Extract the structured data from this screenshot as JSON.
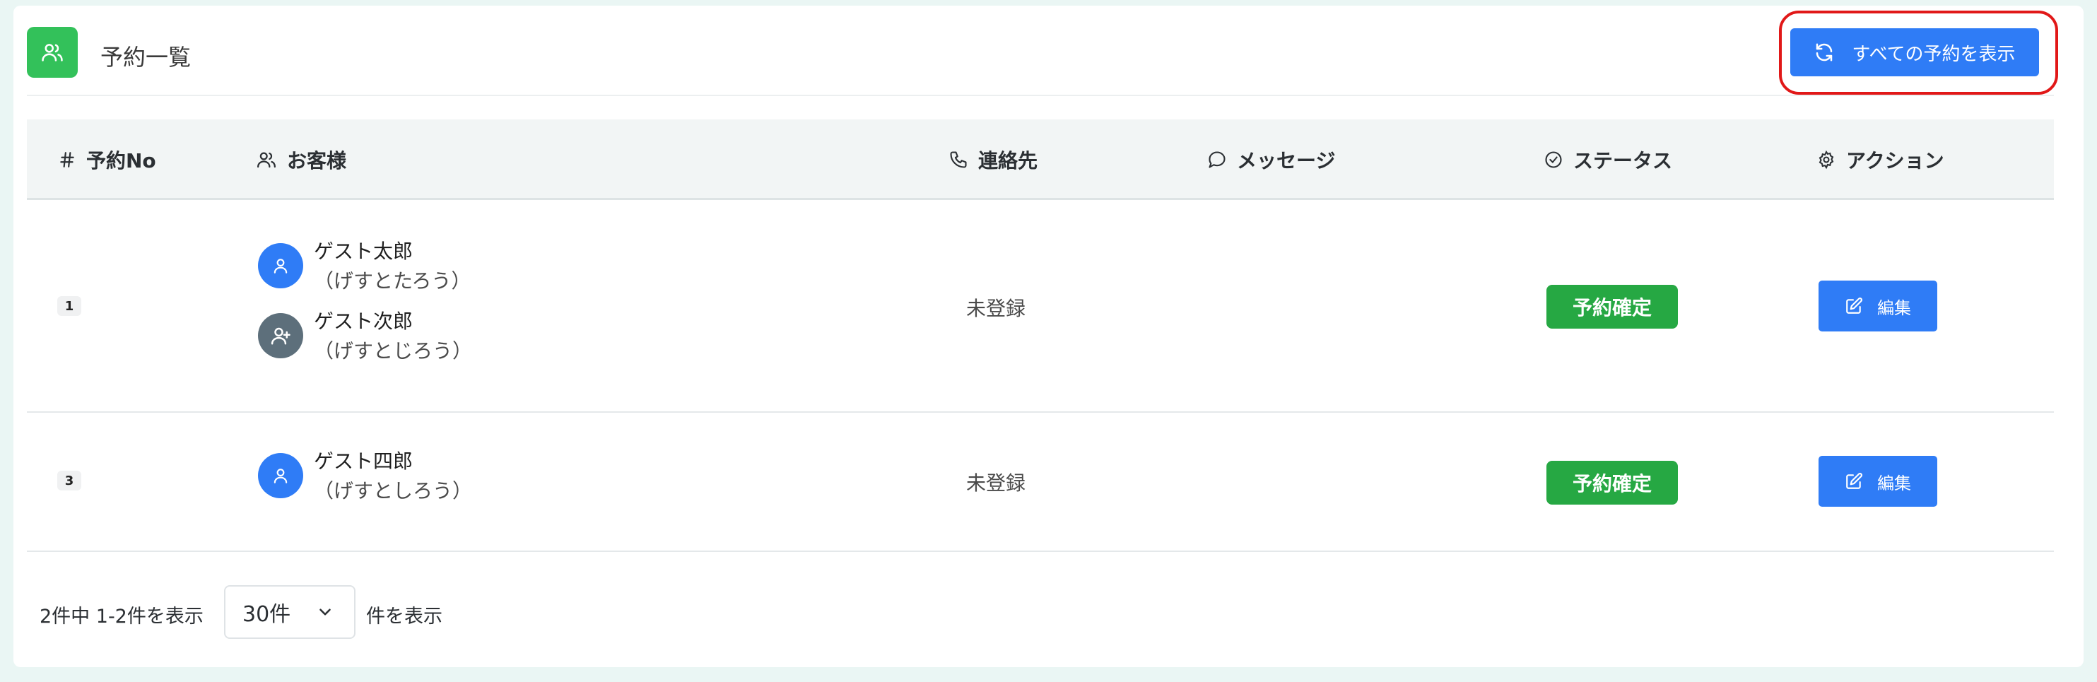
{
  "header": {
    "title": "予約一覧",
    "show_all_label": "すべての予約を表示"
  },
  "table": {
    "columns": {
      "no": "予約No",
      "customer": "お客様",
      "contact": "連絡先",
      "message": "メッセージ",
      "status": "ステータス",
      "action": "アクション"
    },
    "rows": [
      {
        "no": "1",
        "guests": [
          {
            "name": "ゲスト太郎",
            "kana": "（げすとたろう）"
          },
          {
            "name": "ゲスト次郎",
            "kana": "（げすとじろう）"
          }
        ],
        "contact": "未登録",
        "message": "",
        "status": "予約確定",
        "action": "編集"
      },
      {
        "no": "3",
        "guests": [
          {
            "name": "ゲスト四郎",
            "kana": "（げすとしろう）"
          }
        ],
        "contact": "未登録",
        "message": "",
        "status": "予約確定",
        "action": "編集"
      }
    ]
  },
  "footer": {
    "range_text": "2件中 1-2件を表示",
    "per_page_value": "30件",
    "per_page_suffix": "件を表示"
  },
  "colors": {
    "primary": "#2f7cf6",
    "success": "#26a843",
    "header_icon": "#33c15a",
    "highlight": "#e11818"
  }
}
